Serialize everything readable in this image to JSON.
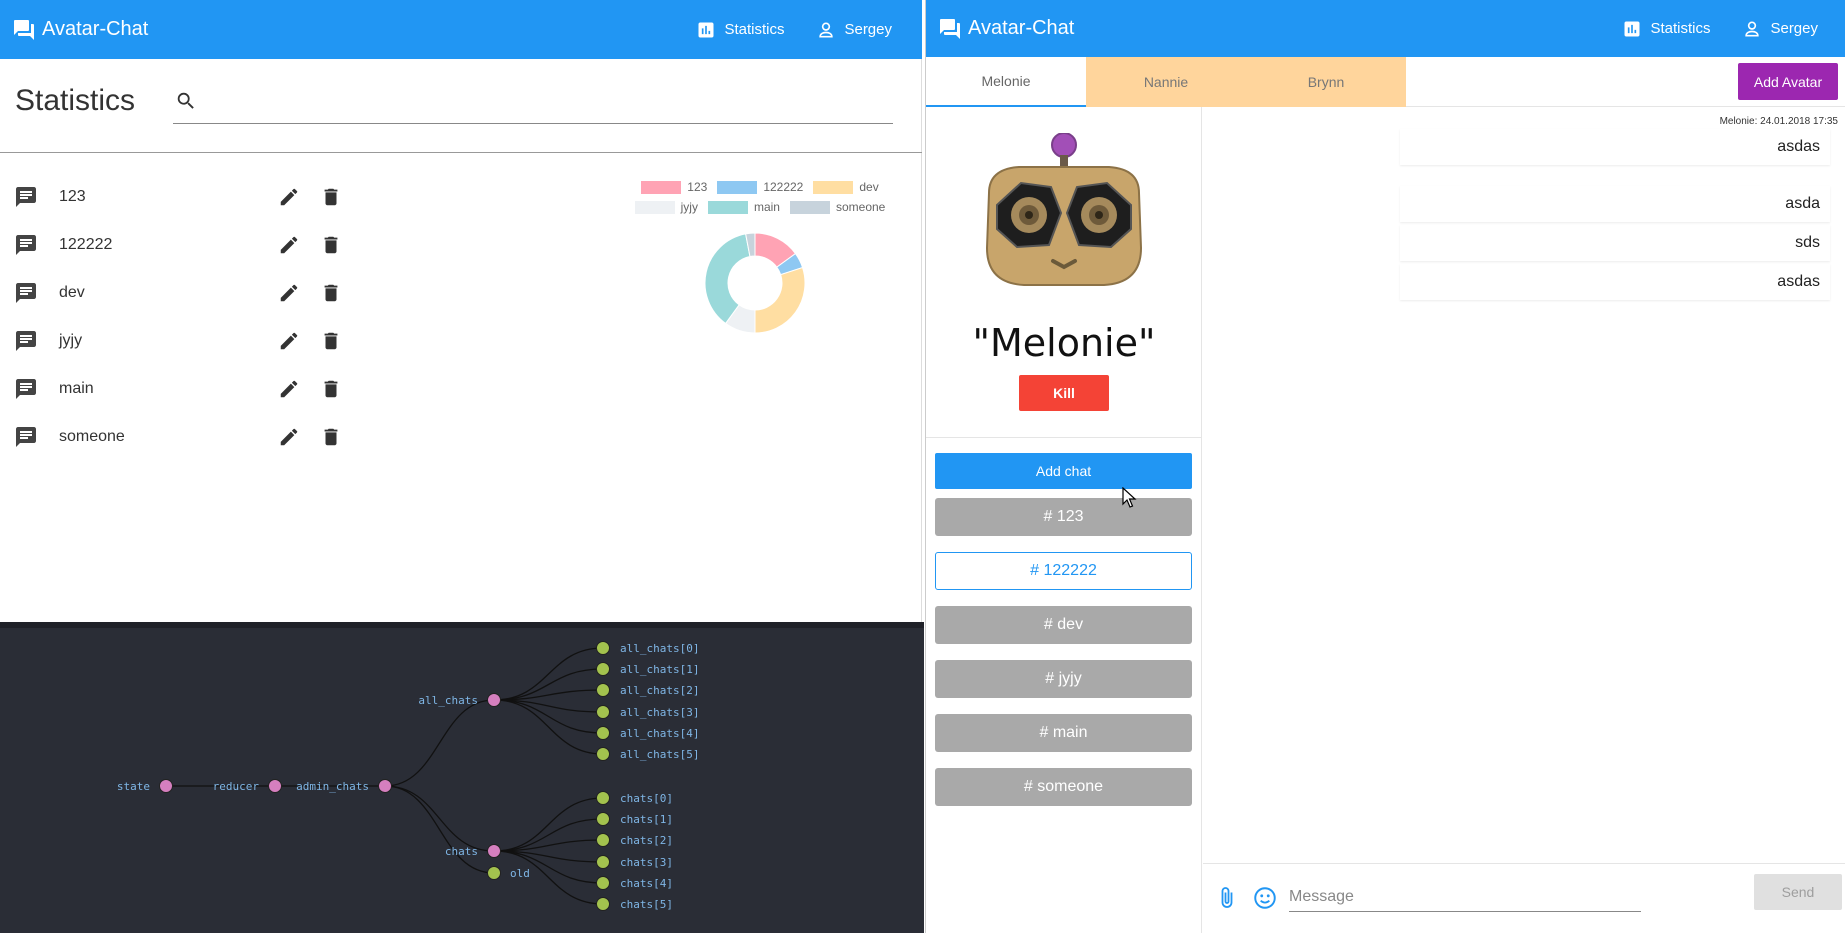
{
  "left": {
    "header": {
      "brand": "Avatar-Chat",
      "statistics_label": "Statistics",
      "user_label": "Sergey"
    },
    "page_title": "Statistics",
    "search": {
      "placeholder": "",
      "value": ""
    },
    "chats": [
      {
        "name": "123"
      },
      {
        "name": "122222"
      },
      {
        "name": "dev"
      },
      {
        "name": "jyjy"
      },
      {
        "name": "main"
      },
      {
        "name": "someone"
      }
    ]
  },
  "chart_data": {
    "type": "pie",
    "title": "",
    "legend_position": "top",
    "categories": [
      "123",
      "122222",
      "dev",
      "jyjy",
      "main",
      "someone"
    ],
    "values": [
      15,
      5,
      30,
      10,
      37,
      3
    ],
    "colors": [
      "#ffa3b4",
      "#8ec8f2",
      "#ffdea2",
      "#eef1f4",
      "#9ad9da",
      "#c7d3dc"
    ]
  },
  "devtools": {
    "nodes": {
      "state": "state",
      "reducer": "reducer",
      "admin_chats": "admin_chats",
      "all_chats": "all_chats",
      "chats": "chats",
      "old": "old"
    },
    "all_chats_children": [
      "all_chats[0]",
      "all_chats[1]",
      "all_chats[2]",
      "all_chats[3]",
      "all_chats[4]",
      "all_chats[5]"
    ],
    "chats_children": [
      "chats[0]",
      "chats[1]",
      "chats[2]",
      "chats[3]",
      "chats[4]",
      "chats[5]"
    ]
  },
  "right": {
    "header": {
      "brand": "Avatar-Chat",
      "statistics_label": "Statistics",
      "user_label": "Sergey"
    },
    "tabs": [
      {
        "label": "Melonie",
        "active": true
      },
      {
        "label": "Nannie",
        "active": false
      },
      {
        "label": "Brynn",
        "active": false
      }
    ],
    "add_avatar_label": "Add Avatar",
    "avatar_name": "\"Melonie\"",
    "kill_label": "Kill",
    "add_chat_label": "Add chat",
    "rooms": [
      {
        "label": "# 123",
        "active": false
      },
      {
        "label": "# 122222",
        "active": true
      },
      {
        "label": "# dev",
        "active": false
      },
      {
        "label": "# jyjy",
        "active": false
      },
      {
        "label": "# main",
        "active": false
      },
      {
        "label": "# someone",
        "active": false
      }
    ],
    "message_meta": "Melonie: 24.01.2018 17:35",
    "messages": [
      "asdas",
      "asda",
      "sds",
      "asdas"
    ],
    "composer": {
      "placeholder": "Message",
      "send_label": "Send"
    }
  }
}
